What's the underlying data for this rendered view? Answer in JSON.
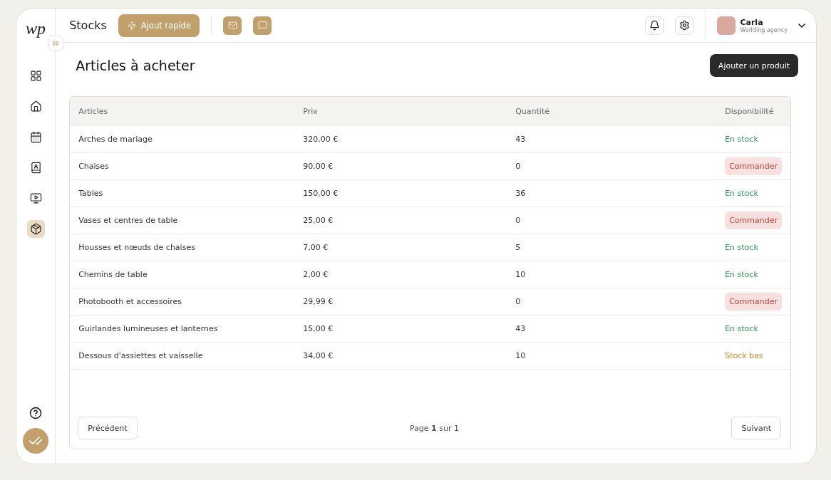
{
  "logo": "wp",
  "header": {
    "title": "Stocks",
    "quick_add": "Ajout rapide",
    "user": {
      "name": "Carla",
      "role": "Wedding agency"
    }
  },
  "sidebar": {
    "items": [
      {
        "kind": "grid",
        "selected": false
      },
      {
        "kind": "home",
        "selected": false
      },
      {
        "kind": "calendar",
        "selected": false
      },
      {
        "kind": "contacts",
        "selected": false
      },
      {
        "kind": "screen",
        "selected": false
      },
      {
        "kind": "package",
        "selected": true
      }
    ]
  },
  "page": {
    "title": "Articles à acheter",
    "add_button": "Ajouter un produit"
  },
  "table": {
    "columns": [
      "Articles",
      "Prix",
      "Quantité",
      "Disponibilité"
    ],
    "rows": [
      {
        "article": "Arches de mariage",
        "price": "320,00 €",
        "quantity": "43",
        "status": "En stock",
        "kind": "in_stock"
      },
      {
        "article": "Chaises",
        "price": "90,00 €",
        "quantity": "0",
        "status": "Commander",
        "kind": "order"
      },
      {
        "article": "Tables",
        "price": "150,00 €",
        "quantity": "36",
        "status": "En stock",
        "kind": "in_stock"
      },
      {
        "article": "Vases et centres de table",
        "price": "25,00 €",
        "quantity": "0",
        "status": "Commander",
        "kind": "order"
      },
      {
        "article": "Housses et nœuds de chaises",
        "price": "7,00 €",
        "quantity": "5",
        "status": "En stock",
        "kind": "in_stock"
      },
      {
        "article": "Chemins de table",
        "price": "2,00 €",
        "quantity": "10",
        "status": "En stock",
        "kind": "in_stock"
      },
      {
        "article": "Photobooth et accessoires",
        "price": "29,99 €",
        "quantity": "0",
        "status": "Commander",
        "kind": "order"
      },
      {
        "article": "Guirlandes lumineuses et lanternes",
        "price": "15,00 €",
        "quantity": "43",
        "status": "En stock",
        "kind": "in_stock"
      },
      {
        "article": "Dessous d'assiettes et vaisselle",
        "price": "34,00 €",
        "quantity": "10",
        "status": "Stock bas",
        "kind": "low"
      }
    ]
  },
  "pagination": {
    "previous": "Précédent",
    "info": "Page **1** sur 1",
    "next": "Suivant"
  }
}
